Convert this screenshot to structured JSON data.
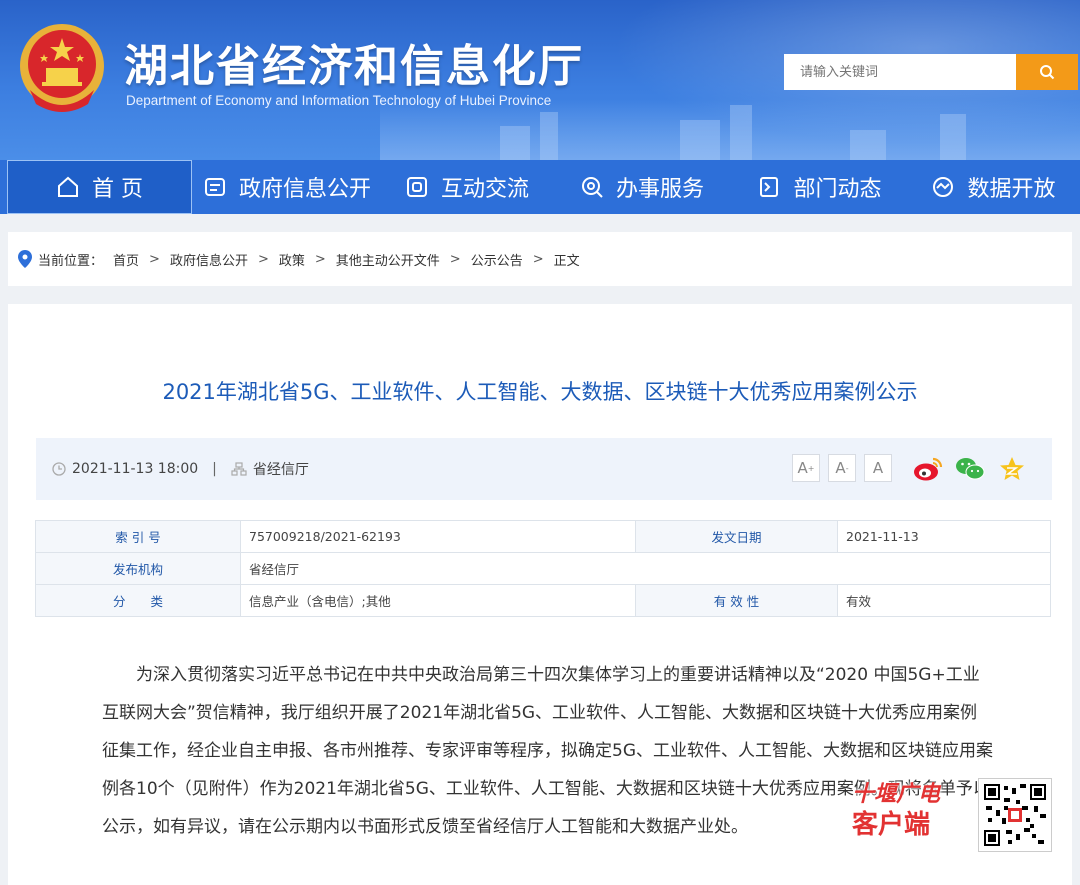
{
  "header": {
    "title": "湖北省经济和信息化厅",
    "subtitle": "Department of Economy and Information Technology of Hubei Province",
    "search_placeholder": "请输入关键词",
    "colors": {
      "brand_blue": "#2d6fd9",
      "search_orange": "#f39a18"
    }
  },
  "nav": {
    "items": [
      {
        "label": "首 页",
        "icon": "home-icon",
        "active": true
      },
      {
        "label": "政府信息公开",
        "icon": "document-icon"
      },
      {
        "label": "互动交流",
        "icon": "chat-icon"
      },
      {
        "label": "办事服务",
        "icon": "search-service-icon"
      },
      {
        "label": "部门动态",
        "icon": "news-icon"
      },
      {
        "label": "数据开放",
        "icon": "data-icon"
      }
    ]
  },
  "breadcrumb": {
    "label": "当前位置：",
    "items": [
      "首页",
      "政府信息公开",
      "政策",
      "其他主动公开文件",
      "公示公告",
      "正文"
    ],
    "separator": ">"
  },
  "article": {
    "title": "2021年湖北省5G、工业软件、人工智能、大数据、区块链十大优秀应用案例公示",
    "datetime": "2021-11-13 18:00",
    "publisher": "省经信厅",
    "font_buttons": [
      "A",
      "A",
      "A"
    ],
    "info": {
      "index_label": "索 引 号",
      "index_value": "757009218/2021-62193",
      "date_label": "发文日期",
      "date_value": "2021-11-13",
      "org_label": "发布机构",
      "org_value": "省经信厅",
      "category_label": "分　　类",
      "category_value": "信息产业（含电信）;其他",
      "validity_label": "有 效 性",
      "validity_value": "有效"
    },
    "body": "为深入贯彻落实习近平总书记在中共中央政治局第三十四次集体学习上的重要讲话精神以及“2020 中国5G+工业互联网大会”贺信精神，我厅组织开展了2021年湖北省5G、工业软件、人工智能、大数据和区块链十大优秀应用案例征集工作，经企业自主申报、各市州推荐、专家评审等程序，拟确定5G、工业软件、人工智能、大数据和区块链应用案例各10个（见附件）作为2021年湖北省5G、工业软件、人工智能、大数据和区块链十大优秀应用案例。现将名单予以公示，如有异议，请在公示期内以书面形式反馈至省经信厅人工智能和大数据产业处。"
  },
  "watermark": {
    "line1": "十堰广电",
    "line2": "客户端"
  }
}
